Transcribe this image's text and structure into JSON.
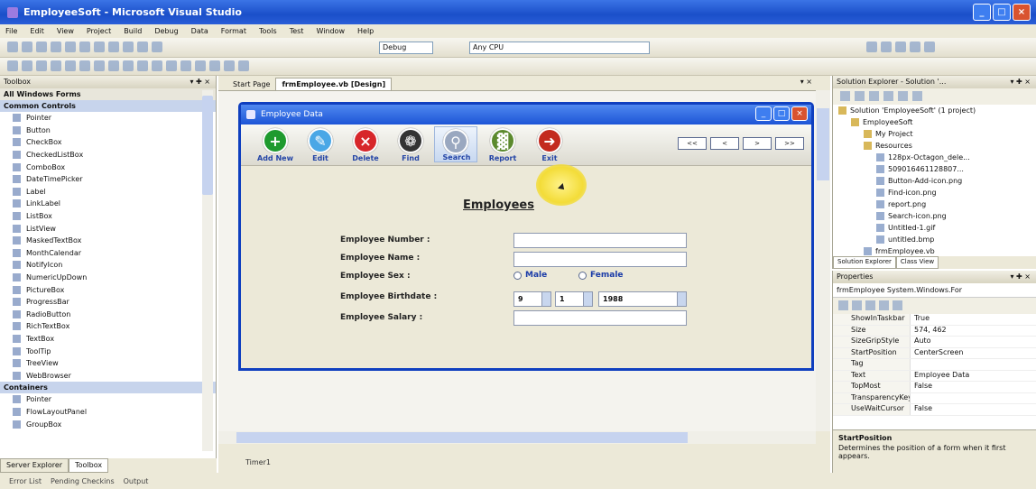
{
  "window": {
    "title": "EmployeeSoft - Microsoft Visual Studio"
  },
  "menu": [
    "File",
    "Edit",
    "View",
    "Project",
    "Build",
    "Debug",
    "Data",
    "Format",
    "Tools",
    "Test",
    "Window",
    "Help"
  ],
  "toolbar": {
    "config": "Debug",
    "platform": "Any CPU"
  },
  "toolbox": {
    "title": "Toolbox",
    "group_all": "All Windows Forms",
    "group_common": "Common Controls",
    "items": [
      "Pointer",
      "Button",
      "CheckBox",
      "CheckedListBox",
      "ComboBox",
      "DateTimePicker",
      "Label",
      "LinkLabel",
      "ListBox",
      "ListView",
      "MaskedTextBox",
      "MonthCalendar",
      "NotifyIcon",
      "NumericUpDown",
      "PictureBox",
      "ProgressBar",
      "RadioButton",
      "RichTextBox",
      "TextBox",
      "ToolTip",
      "TreeView",
      "WebBrowser"
    ],
    "group_containers": "Containers",
    "container_items": [
      "Pointer",
      "FlowLayoutPanel",
      "GroupBox"
    ],
    "bottom_tabs": [
      "Server Explorer",
      "Toolbox"
    ]
  },
  "status_tabs": [
    "Error List",
    "Pending Checkins",
    "Output"
  ],
  "document": {
    "tabs": [
      "Start Page",
      "frmEmployee.vb [Design]"
    ],
    "close": "▾ ×",
    "tray_item": "Timer1"
  },
  "form": {
    "title": "Employee Data",
    "toolbar": [
      {
        "label": "Add New",
        "color": "#1e9a2e",
        "glyph": "+"
      },
      {
        "label": "Edit",
        "color": "#4aa7e6",
        "glyph": "✎"
      },
      {
        "label": "Delete",
        "color": "#d7262a",
        "glyph": "×"
      },
      {
        "label": "Find",
        "color": "#333333",
        "glyph": "❁"
      },
      {
        "label": "Search",
        "color": "#9aa8c0",
        "glyph": "⚲"
      },
      {
        "label": "Report",
        "color": "#5c8a2e",
        "glyph": "▓"
      },
      {
        "label": "Exit",
        "color": "#c32a1e",
        "glyph": "➜"
      }
    ],
    "nav": [
      "<<",
      "<",
      ">",
      ">>"
    ],
    "heading": "Employees",
    "labels": [
      "Employee Number :",
      "Employee Name :",
      "Employee Sex :",
      "Employee Birthdate :",
      "Employee Salary :"
    ],
    "sex_options": [
      "Male",
      "Female"
    ],
    "birth": {
      "day": "9",
      "month": "1",
      "year": "1988"
    }
  },
  "solution_explorer": {
    "title": "Solution Explorer - Solution '...",
    "items": [
      {
        "text": "Solution 'EmployeeSoft' (1 project)",
        "indent": 0,
        "folder": true
      },
      {
        "text": "EmployeeSoft",
        "indent": 1,
        "folder": true
      },
      {
        "text": "My Project",
        "indent": 2,
        "folder": true
      },
      {
        "text": "Resources",
        "indent": 2,
        "folder": true
      },
      {
        "text": "128px-Octagon_dele...",
        "indent": 3,
        "folder": false
      },
      {
        "text": "509016461128807...",
        "indent": 3,
        "folder": false
      },
      {
        "text": "Button-Add-icon.png",
        "indent": 3,
        "folder": false
      },
      {
        "text": "Find-icon.png",
        "indent": 3,
        "folder": false
      },
      {
        "text": "report.png",
        "indent": 3,
        "folder": false
      },
      {
        "text": "Search-icon.png",
        "indent": 3,
        "folder": false
      },
      {
        "text": "Untitled-1.gif",
        "indent": 3,
        "folder": false
      },
      {
        "text": "untitled.bmp",
        "indent": 3,
        "folder": false
      },
      {
        "text": "frmEmployee.vb",
        "indent": 2,
        "folder": false
      }
    ],
    "tabs": [
      "Solution Explorer",
      "Class View"
    ]
  },
  "properties": {
    "title": "Properties",
    "selected": "frmEmployee  System.Windows.For",
    "rows": [
      {
        "name": "ShowInTaskbar",
        "value": "True"
      },
      {
        "name": "Size",
        "value": "574, 462"
      },
      {
        "name": "SizeGripStyle",
        "value": "Auto"
      },
      {
        "name": "StartPosition",
        "value": "CenterScreen"
      },
      {
        "name": "Tag",
        "value": ""
      },
      {
        "name": "Text",
        "value": "Employee Data"
      },
      {
        "name": "TopMost",
        "value": "False"
      },
      {
        "name": "TransparencyKey",
        "value": ""
      },
      {
        "name": "UseWaitCursor",
        "value": "False"
      }
    ],
    "desc_title": "StartPosition",
    "desc_text": "Determines the position of a form when it first appears."
  }
}
